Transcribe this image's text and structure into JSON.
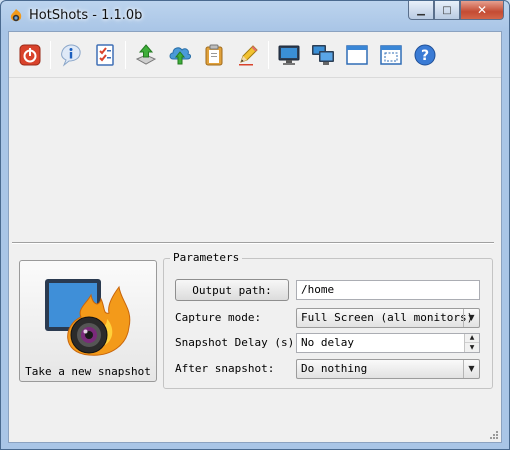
{
  "window": {
    "title": "HotShots - 1.1.0b",
    "minimize_glyph": "▁",
    "maximize_glyph": "□",
    "close_glyph": "✕"
  },
  "toolbar": {
    "buttons": [
      {
        "name": "quit-button",
        "icon": "power-icon"
      },
      {
        "name": "about-button",
        "icon": "info-icon"
      },
      {
        "name": "preferences-button",
        "icon": "checklist-icon"
      },
      {
        "name": "save-button",
        "icon": "save-download-icon"
      },
      {
        "name": "upload-button",
        "icon": "cloud-upload-icon"
      },
      {
        "name": "clipboard-button",
        "icon": "clipboard-icon"
      },
      {
        "name": "editor-button",
        "icon": "pencil-icon"
      },
      {
        "name": "screen-mode-button",
        "icon": "monitor-icon"
      },
      {
        "name": "multi-screen-mode-button",
        "icon": "multi-monitor-icon"
      },
      {
        "name": "window-mode-button",
        "icon": "window-icon"
      },
      {
        "name": "region-mode-button",
        "icon": "region-icon"
      },
      {
        "name": "help-button",
        "icon": "help-icon"
      }
    ]
  },
  "snapshot": {
    "button_label": "Take a new snapshot",
    "icon": "flaming-camera-icon"
  },
  "parameters": {
    "legend": "Parameters",
    "output_path_button": "Output path:",
    "output_path_value": "/home",
    "capture_mode_label": "Capture mode:",
    "capture_mode_value": "Full Screen (all monitors)",
    "delay_label": "Snapshot Delay (s):",
    "delay_value": "No delay",
    "after_label": "After snapshot:",
    "after_value": "Do nothing"
  },
  "colors": {
    "accent_blue": "#3a7bd5",
    "power_red": "#d9432c",
    "flame_orange": "#f39a1a",
    "close_red": "#c44b33"
  }
}
